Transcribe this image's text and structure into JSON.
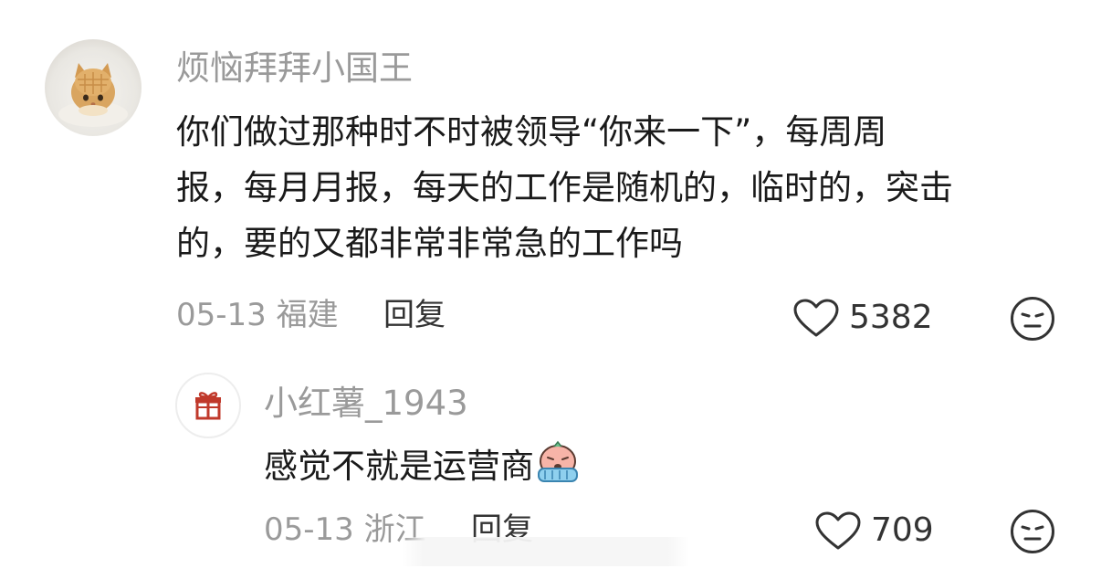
{
  "comments": [
    {
      "username": "烦恼拜拜小国王",
      "text_lines": [
        "你们做过那种时不时被领导“你来一下”，每周周",
        "报，每月月报，每天的工作是随机的，临时的，突击",
        "的，要的又都非常非常急的工作吗"
      ],
      "date": "05-13",
      "location": "福建",
      "reply_label": "回复",
      "likes": "5382",
      "avatar_icon": "cat-avatar-icon"
    },
    {
      "username": "小红薯_1943",
      "text": "感觉不就是运营商",
      "emoji_icon": "crying-face-emoji-icon",
      "date": "05-13",
      "location": "浙江",
      "reply_label": "回复",
      "likes": "709",
      "avatar_icon": "gift-icon"
    }
  ],
  "colors": {
    "username": "#9a9a9a",
    "text": "#1a1a1a",
    "meta": "#9a9a9a",
    "action": "#333333",
    "gift_red": "#c0392b"
  }
}
